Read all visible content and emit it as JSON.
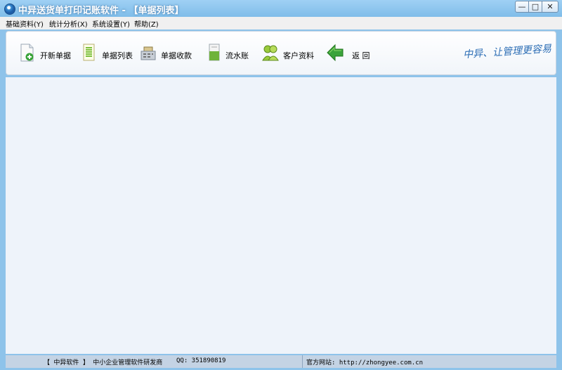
{
  "window": {
    "title": "中异送货单打印记账软件 - 【单据列表】",
    "controls": {
      "minimize": "—",
      "maximize": "□",
      "close": "✕"
    }
  },
  "menu": [
    {
      "label": "基础资料(Y)"
    },
    {
      "label": "统计分析(X)"
    },
    {
      "label": "系统设置(Y)"
    },
    {
      "label": "帮助(Z)"
    }
  ],
  "toolbar": {
    "new_doc": {
      "label": "开新单据",
      "icon": "new-document-icon"
    },
    "doc_list": {
      "label": "单据列表",
      "icon": "document-list-icon"
    },
    "receipts": {
      "label": "单据收款",
      "icon": "cash-register-icon"
    },
    "journal": {
      "label": "流水账",
      "icon": "ledger-icon"
    },
    "customers": {
      "label": "客户资料",
      "icon": "customers-icon"
    },
    "back": {
      "label": "返 回",
      "icon": "back-arrow-icon"
    },
    "signature": "中异、让管理更容易"
  },
  "status": {
    "company": "【 中异软件 】 中小企业管理软件研发商",
    "qq": "QQ: 351890819",
    "website": "官方网站: http://zhongyee.com.cn"
  },
  "colors": {
    "titlebar": "#8ec3ea",
    "content_bg": "#eef3fa",
    "statusbar": "#c4d3e4",
    "accent_green": "#3aa33a"
  }
}
